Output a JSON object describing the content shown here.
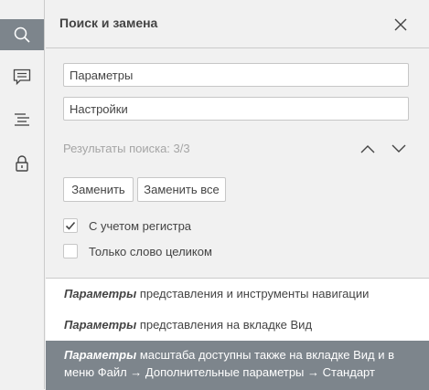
{
  "sidebar": {
    "items": [
      {
        "icon": "search-icon",
        "active": true
      },
      {
        "icon": "comment-icon",
        "active": false
      },
      {
        "icon": "navigation-icon",
        "active": false
      },
      {
        "icon": "lock-icon",
        "active": false
      }
    ]
  },
  "panel": {
    "title": "Поиск и замена"
  },
  "search": {
    "find_value": "Параметры",
    "replace_value": "Настройки"
  },
  "results": {
    "summary": "Результаты поиска: 3/3"
  },
  "buttons": {
    "replace": "Заменить",
    "replace_all": "Заменить все"
  },
  "options": {
    "match_case": {
      "label": "С учетом регистра",
      "checked": true
    },
    "whole_word": {
      "label": "Только слово целиком",
      "checked": false
    }
  },
  "result_items": [
    {
      "match": "Параметры",
      "rest": " представления и инструменты навигации",
      "selected": false
    },
    {
      "match": "Параметры",
      "rest": " представления на вкладке Вид",
      "selected": false
    },
    {
      "match": "Параметры",
      "rest": " масштаба доступны также на вкладке Вид и в меню Файл → Дополнительные параметры → Стандарт",
      "selected": true
    }
  ],
  "colors": {
    "accent": "#7d858c",
    "background": "#f1f1f1",
    "border": "#cbcbcb"
  }
}
